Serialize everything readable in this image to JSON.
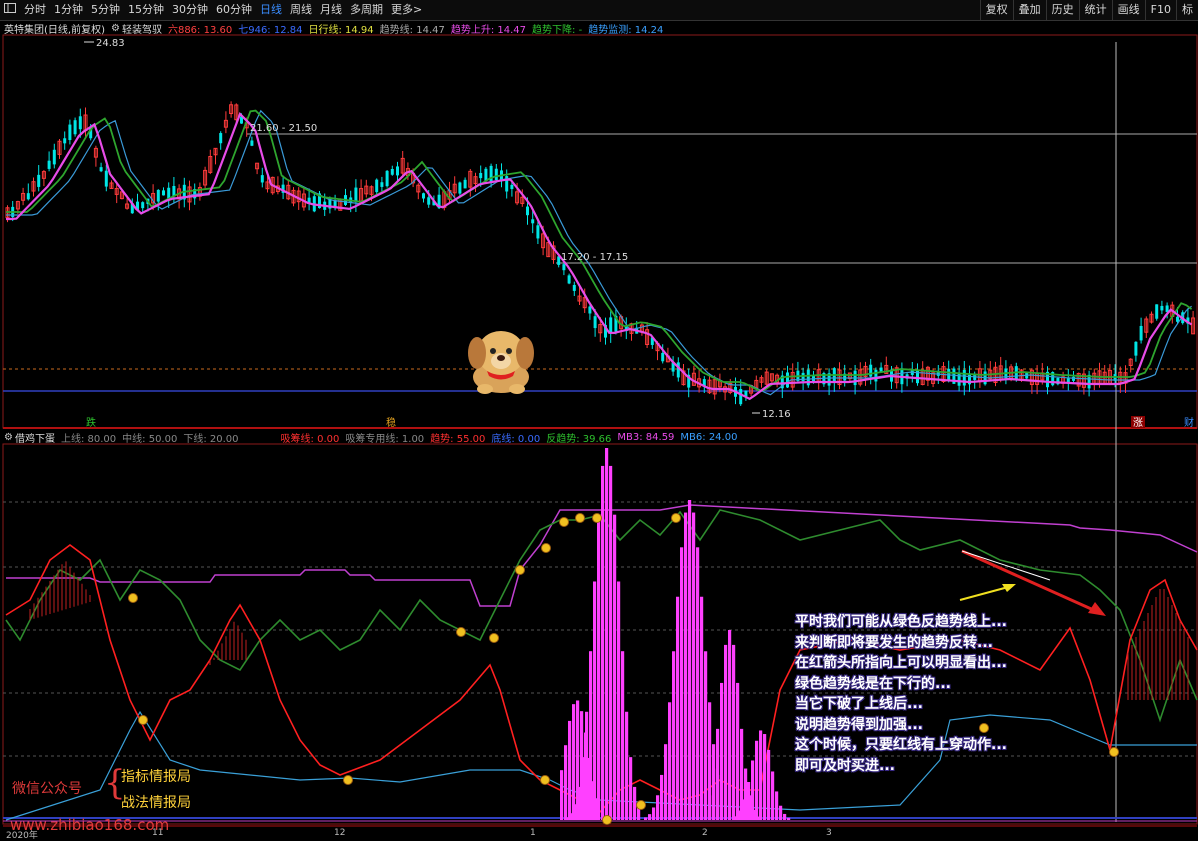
{
  "toolbar": {
    "icon": "window-icon",
    "periods": [
      "分时",
      "1分钟",
      "5分钟",
      "15分钟",
      "30分钟",
      "60分钟",
      "日线",
      "周线",
      "月线",
      "多周期",
      "更多>"
    ],
    "active_period": "日线",
    "right_buttons": [
      "复权",
      "叠加",
      "历史",
      "统计",
      "画线",
      "F10",
      "标"
    ]
  },
  "main_info": {
    "stock": "英特集团(日线,前复权)",
    "template": "轻装驾驭",
    "ma6": "六886: 13.60",
    "ma7": "七946: 12.84",
    "day_line": "日行线: 14.94",
    "trend_line": "趋势线: 14.47",
    "trend_up": "趋势上升: 14.47",
    "trend_down": "趋势下降: -",
    "trend_monitor": "趋势监测: 14.24"
  },
  "price_labels": {
    "high": "24.83",
    "range1": "21.60 - 21.50",
    "range2": "17.20 - 17.15",
    "low": "12.16",
    "marker_fall": "跌",
    "marker_steady": "稳",
    "marker_rise": "涨",
    "marker_wealth": "财"
  },
  "indicator_info": {
    "name": "借鸡下蛋",
    "upper": "上线: 80.00",
    "middle": "中线: 50.00",
    "lower": "下线: 20.00",
    "absorb": "吸筹线: 0.00",
    "absorb_special": "吸筹专用线: 1.00",
    "trend": "趋势: 55.00",
    "bottom": "底线: 0.00",
    "reverse_trend": "反趋势: 39.66",
    "mb3": "MB3: 84.59",
    "mb6": "MB6: 24.00"
  },
  "annotation": [
    "平时我们可能从绿色反趋势线上...",
    "来判断即将要发生的趋势反转...",
    "在红箭头所指向上可以明显看出...",
    "绿色趋势线是在下行的...",
    "当它下破了上线后...",
    "说明趋势得到加强...",
    "这个时候，只要红线有上穿动作...",
    "即可及时买进..."
  ],
  "watermark": {
    "left": "微信公众号",
    "brace": "{",
    "right1": "指标情报局",
    "right2": "战法情报局",
    "url": "www.zhibiao168.com"
  },
  "axis_months": [
    "2020年",
    "11",
    "12",
    "1",
    "2",
    "3"
  ],
  "colors": {
    "up": "#ff3b3b",
    "down": "#00e6e6",
    "ma_magenta": "#e84ce8",
    "ma_green": "#2ea52e",
    "ma_blue": "#3a9ad8",
    "trend_red": "#ff2020",
    "reverse_green": "#2e8b2e",
    "absorb_pink": "#ff40ff"
  }
}
